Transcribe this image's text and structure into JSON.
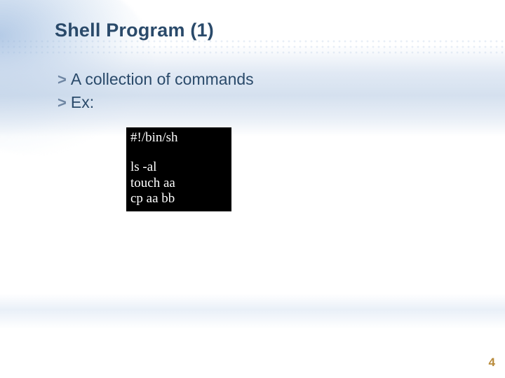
{
  "title": "Shell Program (1)",
  "bullets": [
    {
      "marker": ">",
      "text": "A collection of commands"
    },
    {
      "marker": ">",
      "text": "Ex:"
    }
  ],
  "code": {
    "lines": [
      "#!/bin/sh",
      "",
      "ls -al",
      "touch aa",
      "cp aa bb"
    ]
  },
  "page_number": "4"
}
